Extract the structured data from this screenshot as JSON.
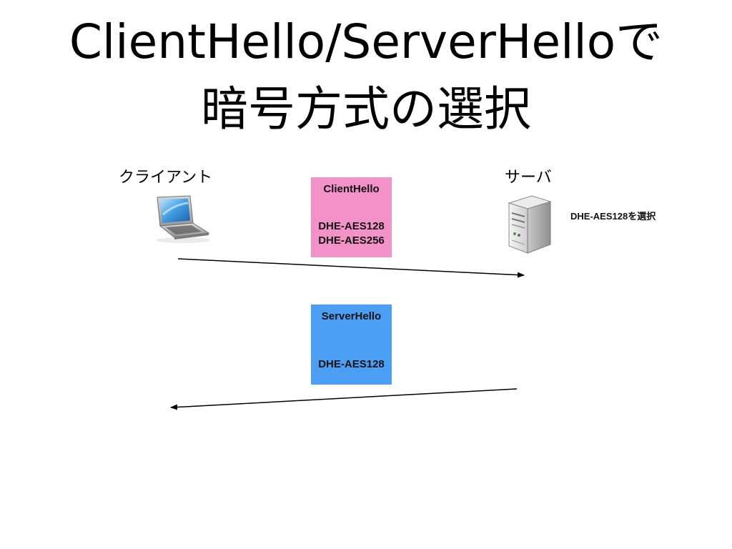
{
  "title": {
    "line1": "ClientHello/ServerHelloで",
    "line2": "暗号方式の選択"
  },
  "actors": {
    "client": {
      "label": "クライアント",
      "icon": "laptop-icon"
    },
    "server": {
      "label": "サーバ",
      "icon": "server-icon"
    }
  },
  "messages": {
    "client_hello": {
      "title": "ClientHello",
      "ciphers": [
        "DHE-AES128",
        "DHE-AES256"
      ],
      "color": "#f292c8",
      "direction": "client-to-server"
    },
    "server_hello": {
      "title": "ServerHello",
      "ciphers": [
        "DHE-AES128"
      ],
      "color": "#4a9ff5",
      "direction": "server-to-client"
    }
  },
  "server_note": "DHE-AES128を選択"
}
